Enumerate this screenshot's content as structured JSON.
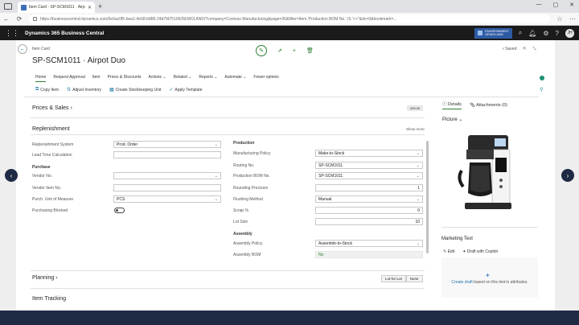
{
  "browser": {
    "tab_title": "Item Card - SP-SCM1011 · Airp...",
    "address_host": "businesscentral.dynamics.com",
    "address_url": "https://businesscentral.dynamics.com/6e0ac0f5-bea1-4e68-b886-24d7fd75106/DEMOLAND/?company=Contoso Manufacturing&page=30&filter=Item.'Production BOM No.' IS '<>''&dc=0&bookmark=..."
  },
  "app": {
    "title": "Dynamics 365 Business Central",
    "company_line1": "ENVIRONMENT",
    "company_line2": "DEMOLAND",
    "avatar": "JH"
  },
  "page": {
    "kicker": "Item Card",
    "title": "SP-SCM1011 · Airpot Duo",
    "saved": "✓Saved"
  },
  "menu": [
    "Home",
    "Request Approval",
    "Item",
    "Prices & Discounts",
    "Actions ⌄",
    "Related ⌄",
    "Reports ⌄",
    "Automate ⌄",
    "Fewer options"
  ],
  "actions": [
    "Copy Item",
    "Adjust Inventory",
    "Create Stockkeeping Unit",
    "Apply Template"
  ],
  "sections": {
    "prices": "Prices & Sales",
    "prices_badge": "499.00",
    "replenishment": "Replenishment",
    "show_more": "Show more",
    "planning": "Planning",
    "item_tracking": "Item Tracking"
  },
  "left": {
    "replenishment_system_label": "Replenishment System",
    "replenishment_system": "Prod. Order",
    "lead_time_label": "Lead Time Calculation",
    "purchase_header": "Purchase",
    "vendor_no_label": "Vendor No.",
    "vendor_item_label": "Vendor Item No.",
    "purch_uom_label": "Purch. Unit of Measure",
    "purch_uom": "PCS",
    "blocked_label": "Purchasing Blocked"
  },
  "right": {
    "production_header": "Production",
    "mfg_policy_label": "Manufacturing Policy",
    "mfg_policy": "Make-to-Stock",
    "routing_label": "Routing No.",
    "routing": "SP-SCM1011",
    "bom_label": "Production BOM No.",
    "bom": "SP-SCM1011",
    "rounding_label": "Rounding Precision",
    "rounding": "1",
    "flushing_label": "Flushing Method",
    "flushing": "Manual",
    "scrap_label": "Scrap %",
    "scrap": "0",
    "lot_label": "Lot Size",
    "lot": "10",
    "assembly_header": "Assembly",
    "asm_policy_label": "Assembly Policy",
    "asm_policy": "Assemble-to-Stock",
    "asm_bom_label": "Assembly BOM",
    "asm_bom": "No"
  },
  "planning_pills": [
    "Lot-for-Lot",
    "None"
  ],
  "factbox": {
    "details": "Details",
    "attachments": "Attachments (0)",
    "picture": "Picture",
    "marketing": "Marketing Text",
    "edit": "Edit",
    "draft": "Draft with Copilot",
    "create_link": "Create draft",
    "create_rest": " based on this item's attributes."
  }
}
